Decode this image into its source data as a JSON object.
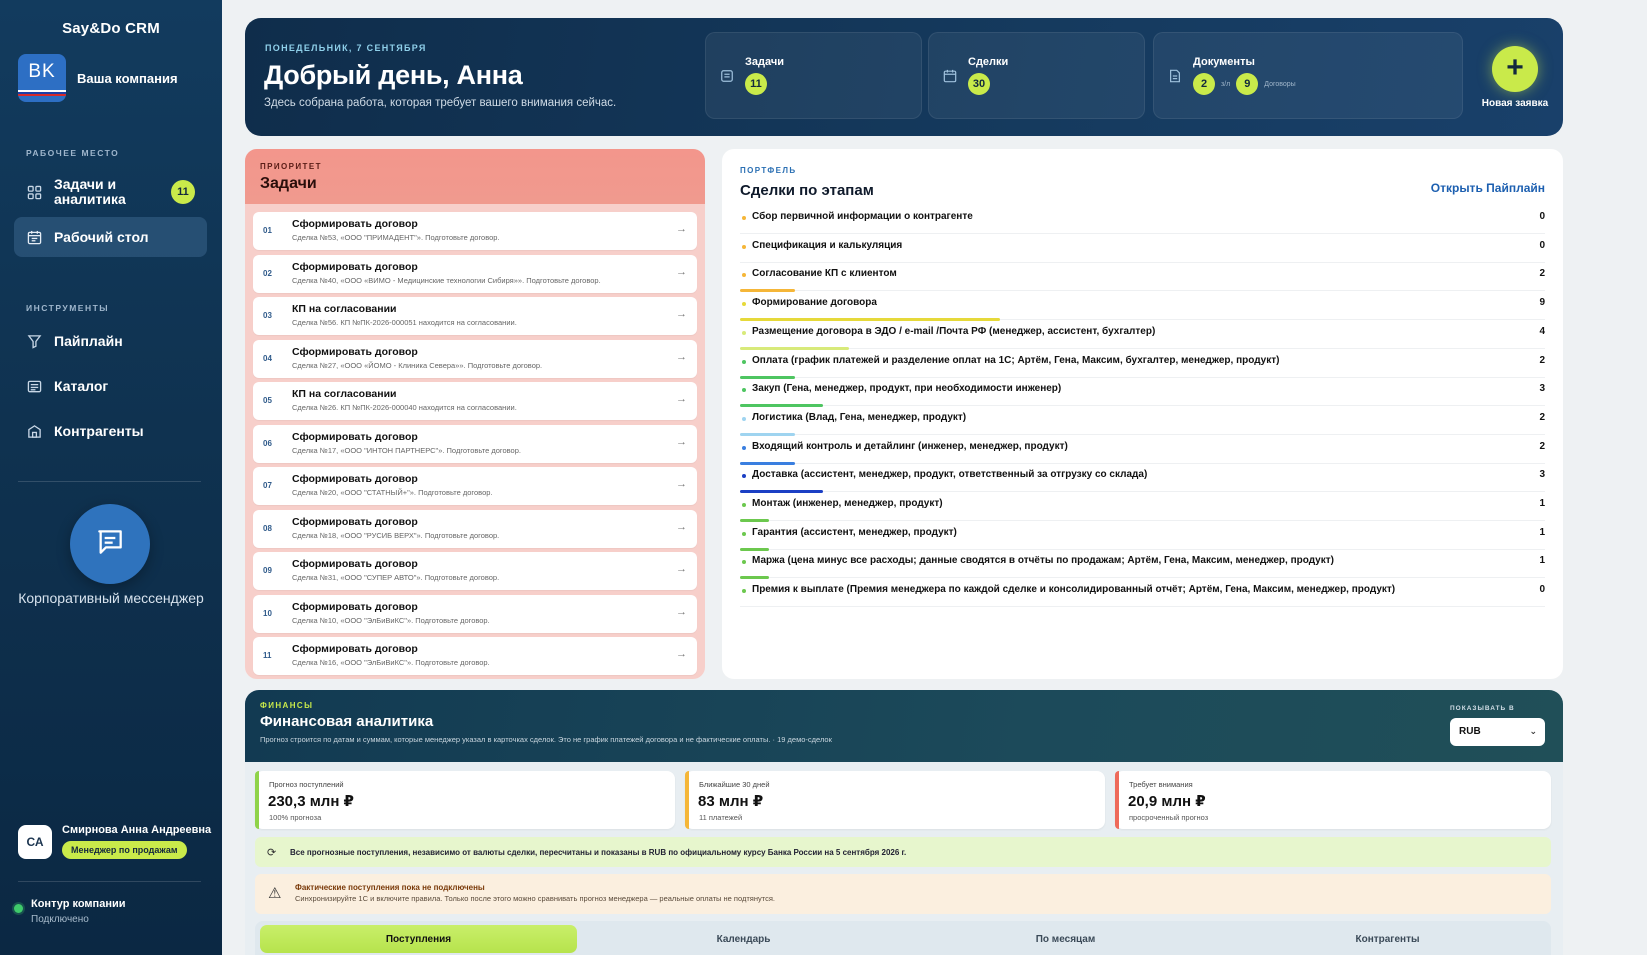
{
  "sidebar": {
    "app_title": "Say&Do CRM",
    "company_logo": "BK",
    "company_name": "Ваша компания",
    "section_workspace": "РАБОЧЕЕ МЕСТО",
    "section_tools": "ИНСТРУМЕНТЫ",
    "nav_tasks": {
      "label": "Задачи и аналитика",
      "badge": "11",
      "icon": "grid-icon"
    },
    "nav_desk": {
      "label": "Рабочий стол",
      "icon": "calendar-icon"
    },
    "nav_pipeline": {
      "label": "Пайплайн",
      "icon": "funnel-icon"
    },
    "nav_catalog": {
      "label": "Каталог",
      "icon": "catalog-icon"
    },
    "nav_contractors": {
      "label": "Контрагенты",
      "icon": "building-icon"
    },
    "messenger_label": "Корпоративный мессенджер",
    "user": {
      "initials": "СА",
      "name": "Смирнова Анна Андреевна",
      "role": "Менеджер по продажам"
    },
    "contour": {
      "title": "Контур компании",
      "status": "Подключено",
      "status_color": "#3fca6b"
    }
  },
  "header": {
    "date": "ПОНЕДЕЛЬНИК, 7 СЕНТЯБРЯ",
    "title": "Добрый день, Анна",
    "subtitle": "Здесь собрана работа, которая требует вашего внимания сейчас.",
    "stats": {
      "tasks": {
        "title": "Задачи",
        "value": "11"
      },
      "deals": {
        "title": "Сделки",
        "value": "30"
      },
      "docs": {
        "title": "Документы",
        "value1": "2",
        "sep": "з/л",
        "value2": "9",
        "suffix": "Договоры"
      }
    },
    "new_request": "Новая заявка"
  },
  "tasks": {
    "kicker": "ПРИОРИТЕТ",
    "title": "Задачи",
    "items": [
      {
        "num": "01",
        "title": "Сформировать договор",
        "desc": "Сделка №53, «ООО \"ПРИМАДЕНТ\"». Подготовьте договор."
      },
      {
        "num": "02",
        "title": "Сформировать договор",
        "desc": "Сделка №40, «ООО «ВИМО - Медицинские технологии Сибиря»». Подготовьте договор."
      },
      {
        "num": "03",
        "title": "КП на согласовании",
        "desc": "Сделка №56. КП №ПК-2026-000051 находится на согласовании."
      },
      {
        "num": "04",
        "title": "Сформировать договор",
        "desc": "Сделка №27, «ООО «ЙОМО - Клиника Севера»». Подготовьте договор."
      },
      {
        "num": "05",
        "title": "КП на согласовании",
        "desc": "Сделка №26. КП №ПК-2026-000040 находится на согласовании."
      },
      {
        "num": "06",
        "title": "Сформировать договор",
        "desc": "Сделка №17, «ООО \"ИНТОН ПАРТНЕРС\"». Подготовьте договор."
      },
      {
        "num": "07",
        "title": "Сформировать договор",
        "desc": "Сделка №20, «ООО \"СТАТНЫЙ+\"». Подготовьте договор."
      },
      {
        "num": "08",
        "title": "Сформировать договор",
        "desc": "Сделка №18, «ООО \"РУСИБ ВЕРХ\"». Подготовьте договор."
      },
      {
        "num": "09",
        "title": "Сформировать договор",
        "desc": "Сделка №31, «ООО \"СУПЕР АВТО\"». Подготовьте договор."
      },
      {
        "num": "10",
        "title": "Сформировать договор",
        "desc": "Сделка №10, «ООО \"ЭлБиВиКС\"». Подготовьте договор."
      },
      {
        "num": "11",
        "title": "Сформировать договор",
        "desc": "Сделка №16, «ООО \"ЭлБиВиКС\"». Подготовьте договор."
      }
    ]
  },
  "deals": {
    "kicker": "ПОРТФЕЛЬ",
    "title": "Сделки по этапам",
    "link": "Открыть Пайплайн",
    "stages": [
      {
        "name": "Сбор первичной информации о контрагенте",
        "count": "0",
        "color": "#f5b638",
        "fill": 0
      },
      {
        "name": "Спецификация и калькуляция",
        "count": "0",
        "color": "#f5b638",
        "fill": 0
      },
      {
        "name": "Согласование КП с клиентом",
        "count": "2",
        "color": "#f5b638",
        "fill": 0.21
      },
      {
        "name": "Формирование договора",
        "count": "9",
        "color": "#e6d93a",
        "fill": 1
      },
      {
        "name": "Размещение договора в ЭДО / e-mail /Почта РФ (менеджер, ассистент, бухгалтер)",
        "count": "4",
        "color": "#d8ea7a",
        "fill": 0.42
      },
      {
        "name": "Оплата (график платежей и разделение оплат на 1С; Артём, Гена, Максим, бухгалтер, менеджер, продукт)",
        "count": "2",
        "color": "#4ec561",
        "fill": 0.21
      },
      {
        "name": "Закуп (Гена, менеджер, продукт, при необходимости инженер)",
        "count": "3",
        "color": "#4ec561",
        "fill": 0.32
      },
      {
        "name": "Логистика (Влад, Гена, менеджер, продукт)",
        "count": "2",
        "color": "#9fd4f0",
        "fill": 0.21
      },
      {
        "name": "Входящий контроль и детайлинг (инженер, менеджер, продукт)",
        "count": "2",
        "color": "#3a7fe0",
        "fill": 0.21
      },
      {
        "name": "Доставка (ассистент, менеджер, продукт, ответственный за отгрузку со склада)",
        "count": "3",
        "color": "#1b3fc4",
        "fill": 0.32
      },
      {
        "name": "Монтаж (инженер, менеджер, продукт)",
        "count": "1",
        "color": "#6cc84e",
        "fill": 0.11
      },
      {
        "name": "Гарантия (ассистент, менеджер, продукт)",
        "count": "1",
        "color": "#6cc84e",
        "fill": 0.11
      },
      {
        "name": "Маржа (цена минус все расходы; данные сводятся в отчёты по продажам; Артём, Гена, Максим, менеджер, продукт)",
        "count": "1",
        "color": "#6cc84e",
        "fill": 0.11
      },
      {
        "name": "Премия к выплате (Премия менеджера по каждой сделке и консолидированный отчёт; Артём, Гена, Максим, менеджер, продукт)",
        "count": "0",
        "color": "#6cc84e",
        "fill": 0
      }
    ]
  },
  "finance": {
    "kicker": "ФИНАНСЫ",
    "title": "Финансовая аналитика",
    "desc": "Прогноз строится по датам и суммам, которые менеджер указал в карточках сделок. Это не график платежей договора и не фактические оплаты. · 19 демо-сделок",
    "show_label": "ПОКАЗЫВАТЬ В",
    "currency": "RUB",
    "kpis": [
      {
        "label": "Прогноз поступлений",
        "value": "230,3 млн ₽",
        "sub": "100% прогноза",
        "color": "#8fd34a"
      },
      {
        "label": "Ближайшие 30 дней",
        "value": "83 млн ₽",
        "sub": "11 платежей",
        "color": "#f5b638"
      },
      {
        "label": "Требует внимания",
        "value": "20,9 млн ₽",
        "sub": "просроченный прогноз",
        "color": "#ee6a5a"
      }
    ],
    "note": "Все прогнозные поступления, независимо от валюты сделки, пересчитаны и показаны в RUB по официальному курсу Банка России на 5 сентября 2026 г.",
    "warn_title": "Фактические поступления пока не подключены",
    "warn_sub": "Синхронизируйте 1С и включите правила. Только после этого можно сравнивать прогноз менеджера — реальные оплаты не подтянутся.",
    "tabs": [
      "Поступления",
      "Календарь",
      "По месяцам",
      "Контрагенты"
    ]
  }
}
